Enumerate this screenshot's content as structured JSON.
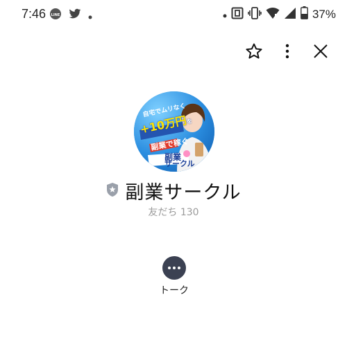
{
  "status_bar": {
    "time": "7:46",
    "battery_percent": "37%",
    "left_icons": [
      "line-icon",
      "twitter-icon",
      "dot-icon"
    ],
    "right_icons": [
      "dot-icon",
      "nfc-icon",
      "vibrate-icon",
      "wifi-icon",
      "signal-icon",
      "battery-icon"
    ]
  },
  "toolbar": {
    "favorite_icon": "star-outline-icon",
    "more_icon": "more-vertical-icon",
    "close_icon": "close-icon"
  },
  "profile": {
    "avatar_text": {
      "line1": "自宅でムリなく",
      "line2": "+10万円",
      "line2_suffix": "を",
      "line3": "副業で稼ぐ",
      "badge_top": "副業",
      "badge_bottom": "サークル"
    },
    "badge_icon": "shield-icon",
    "name": "副業サークル",
    "friends_label": "友だち",
    "friends_count": "130"
  },
  "actions": {
    "talk_label": "トーク",
    "talk_icon": "chat-bubble-icon"
  }
}
